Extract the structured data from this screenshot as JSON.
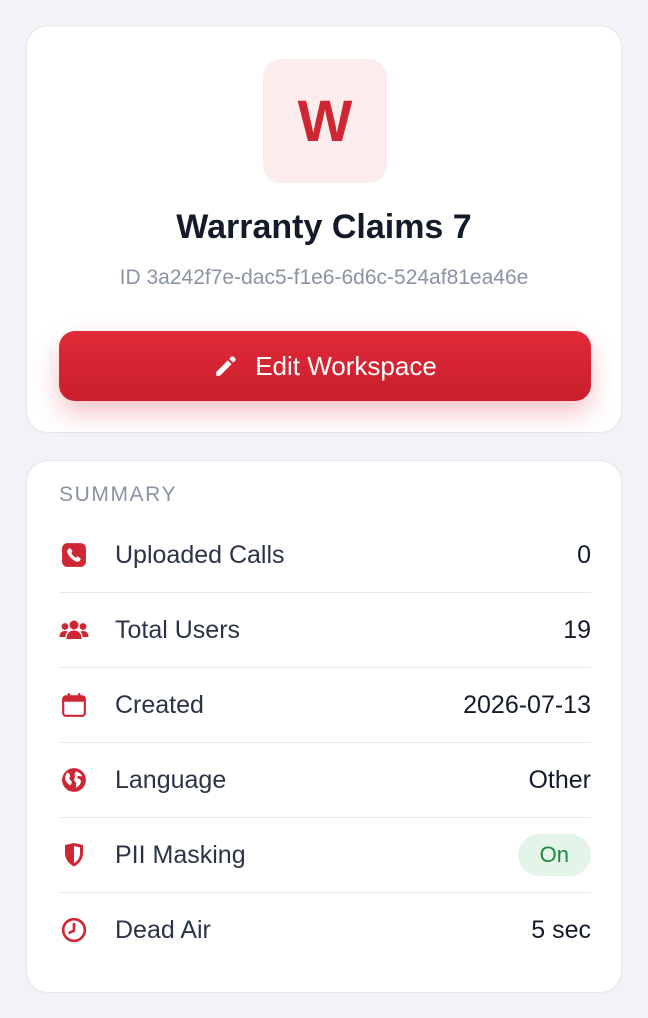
{
  "workspace": {
    "avatar_letter": "W",
    "name": "Warranty Claims 7",
    "id_text": "ID 3a242f7e-dac5-f1e6-6d6c-524af81ea46e",
    "edit_label": "Edit Workspace"
  },
  "summary": {
    "title": "SUMMARY",
    "rows": [
      {
        "icon": "phone-icon",
        "label": "Uploaded Calls",
        "value": "0"
      },
      {
        "icon": "users-icon",
        "label": "Total Users",
        "value": "19"
      },
      {
        "icon": "calendar-icon",
        "label": "Created",
        "value": "2026-07-13"
      },
      {
        "icon": "globe-icon",
        "label": "Language",
        "value": "Other"
      },
      {
        "icon": "shield-icon",
        "label": "PII Masking",
        "value": "On"
      },
      {
        "icon": "clock-icon",
        "label": "Dead Air",
        "value": "5 sec"
      }
    ]
  },
  "colors": {
    "accent": "#cf2633",
    "avatar_bg": "#fdecec",
    "status_on_bg": "#e3f5e8",
    "status_on_text": "#1f8a3f"
  }
}
